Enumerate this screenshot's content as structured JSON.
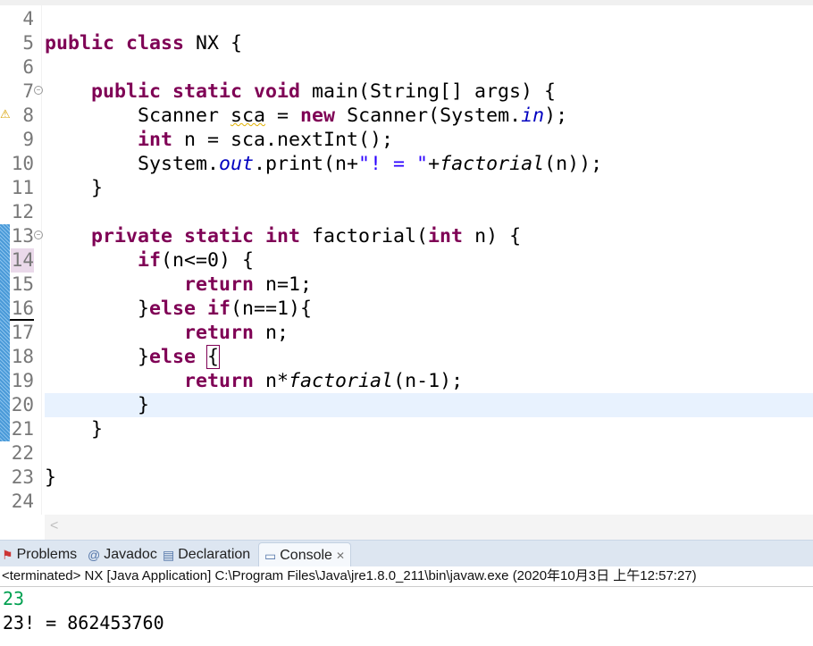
{
  "editor": {
    "lines": [
      {
        "num": "4",
        "segs": []
      },
      {
        "num": "5",
        "segs": [
          {
            "t": "public class ",
            "c": "kw"
          },
          {
            "t": "NX {",
            "c": ""
          }
        ]
      },
      {
        "num": "6",
        "segs": []
      },
      {
        "num": "7",
        "fold": true,
        "segs": [
          {
            "t": "    ",
            "c": ""
          },
          {
            "t": "public static void ",
            "c": "kw"
          },
          {
            "t": "main(String[] args) {",
            "c": ""
          }
        ]
      },
      {
        "num": "8",
        "warn": true,
        "segs": [
          {
            "t": "        Scanner ",
            "c": ""
          },
          {
            "t": "sca",
            "c": "squig"
          },
          {
            "t": " = ",
            "c": ""
          },
          {
            "t": "new ",
            "c": "kw"
          },
          {
            "t": "Scanner(System.",
            "c": ""
          },
          {
            "t": "in",
            "c": "fld"
          },
          {
            "t": ");",
            "c": ""
          }
        ]
      },
      {
        "num": "9",
        "segs": [
          {
            "t": "        ",
            "c": ""
          },
          {
            "t": "int ",
            "c": "kw"
          },
          {
            "t": "n = sca.nextInt();",
            "c": ""
          }
        ]
      },
      {
        "num": "10",
        "segs": [
          {
            "t": "        System.",
            "c": ""
          },
          {
            "t": "out",
            "c": "fld"
          },
          {
            "t": ".print(n+",
            "c": ""
          },
          {
            "t": "\"! = \"",
            "c": "str"
          },
          {
            "t": "+",
            "c": ""
          },
          {
            "t": "factorial",
            "c": "it"
          },
          {
            "t": "(n));",
            "c": ""
          }
        ]
      },
      {
        "num": "11",
        "segs": [
          {
            "t": "    }",
            "c": ""
          }
        ]
      },
      {
        "num": "12",
        "segs": []
      },
      {
        "num": "13",
        "fold": true,
        "segs": [
          {
            "t": "    ",
            "c": ""
          },
          {
            "t": "private static int ",
            "c": "kw"
          },
          {
            "t": "factorial(",
            "c": ""
          },
          {
            "t": "int ",
            "c": "kw"
          },
          {
            "t": "n) {",
            "c": ""
          }
        ]
      },
      {
        "num": "14",
        "hl": true,
        "segs": [
          {
            "t": "        ",
            "c": ""
          },
          {
            "t": "if",
            "c": "kw"
          },
          {
            "t": "(n<=0) {",
            "c": ""
          }
        ]
      },
      {
        "num": "15",
        "segs": [
          {
            "t": "            ",
            "c": ""
          },
          {
            "t": "return ",
            "c": "kw"
          },
          {
            "t": "n=1;",
            "c": ""
          }
        ]
      },
      {
        "num": "16",
        "ul": true,
        "segs": [
          {
            "t": "        }",
            "c": ""
          },
          {
            "t": "else if",
            "c": "kw"
          },
          {
            "t": "(n==1){",
            "c": ""
          }
        ]
      },
      {
        "num": "17",
        "segs": [
          {
            "t": "            ",
            "c": ""
          },
          {
            "t": "return ",
            "c": "kw"
          },
          {
            "t": "n;",
            "c": ""
          }
        ]
      },
      {
        "num": "18",
        "segs": [
          {
            "t": "        }",
            "c": ""
          },
          {
            "t": "else ",
            "c": "kw"
          },
          {
            "t": "{",
            "c": "box"
          }
        ]
      },
      {
        "num": "19",
        "segs": [
          {
            "t": "            ",
            "c": ""
          },
          {
            "t": "return ",
            "c": "kw"
          },
          {
            "t": "n*",
            "c": ""
          },
          {
            "t": "factorial",
            "c": "it"
          },
          {
            "t": "(n-1);",
            "c": ""
          }
        ]
      },
      {
        "num": "20",
        "current": true,
        "segs": [
          {
            "t": "        }",
            "c": ""
          }
        ]
      },
      {
        "num": "21",
        "segs": [
          {
            "t": "    }",
            "c": ""
          }
        ]
      },
      {
        "num": "22",
        "segs": []
      },
      {
        "num": "23",
        "segs": [
          {
            "t": "}",
            "c": ""
          }
        ]
      },
      {
        "num": "24",
        "segs": []
      }
    ]
  },
  "panel": {
    "tabs": [
      {
        "label": "Problems",
        "icon": "problems-icon"
      },
      {
        "label": "Javadoc",
        "icon": "at-icon"
      },
      {
        "label": "Declaration",
        "icon": "declaration-icon"
      },
      {
        "label": "Console",
        "icon": "console-icon",
        "active": true
      }
    ],
    "status": "<terminated> NX [Java Application] C:\\Program Files\\Java\\jre1.8.0_211\\bin\\javaw.exe (2020年10月3日 上午12:57:27)",
    "output": [
      {
        "text": "23",
        "color": "#00a050"
      },
      {
        "text": "23! = 862453760",
        "color": "#000000"
      }
    ]
  }
}
